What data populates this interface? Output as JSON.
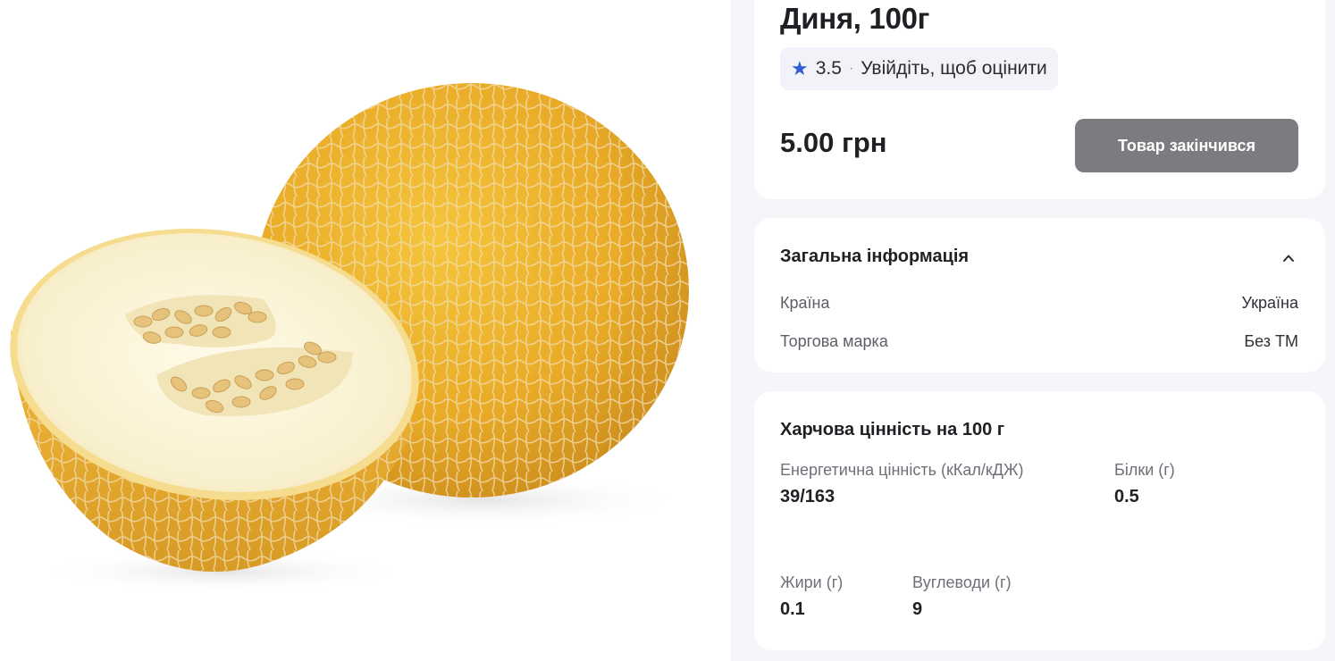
{
  "product": {
    "title": "Диня, 100г",
    "rating_value": "3.5",
    "rating_separator": "·",
    "rating_login_text": "Увійдіть, щоб оцінити",
    "price": "5.00 грн",
    "stock_button_label": "Товар закінчився"
  },
  "general_info": {
    "title": "Загальна інформація",
    "rows": [
      {
        "label": "Країна",
        "value": "Україна"
      },
      {
        "label": "Торгова марка",
        "value": "Без ТМ"
      }
    ]
  },
  "nutrition": {
    "title": "Харчова цінність на 100 г",
    "items": [
      {
        "label": "Енергетична цінність (кКал/кДЖ)",
        "value": "39/163"
      },
      {
        "label": "Білки (г)",
        "value": "0.5"
      },
      {
        "label": "Жири (г)",
        "value": "0.1"
      },
      {
        "label": "Вуглеводи (г)",
        "value": "9"
      }
    ]
  },
  "icons": {
    "rating": "star-icon",
    "collapse": "chevron-up-icon"
  },
  "colors": {
    "accent_star": "#2f5fd0",
    "disabled_button": "#7b7c80",
    "panel_background": "#f5f6f9",
    "melon_skin": "#e8a928",
    "melon_flesh": "#fbf4dc"
  }
}
